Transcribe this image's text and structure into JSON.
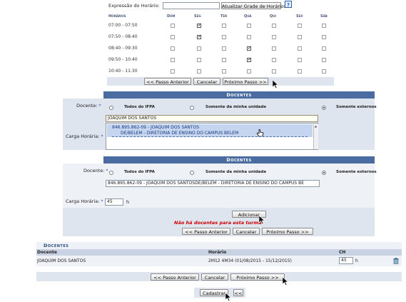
{
  "schedule": {
    "expression_label": "Expressão do Horário:",
    "expression_value": "",
    "update_button": "Atualizar Grade de Horários",
    "help_icon": "?",
    "time_header": "Horários",
    "days": [
      "Dom",
      "Seg",
      "Ter",
      "Qua",
      "Qui",
      "Sex",
      "Sáb"
    ],
    "rows": [
      {
        "time": "07:00 - 07:50",
        "checked": [
          false,
          true,
          false,
          false,
          false,
          false,
          false
        ]
      },
      {
        "time": "07:50 - 08:40",
        "checked": [
          false,
          true,
          false,
          false,
          false,
          false,
          false
        ]
      },
      {
        "time": "08:40 - 09:30",
        "checked": [
          false,
          false,
          false,
          true,
          false,
          false,
          false
        ]
      },
      {
        "time": "09:50 - 10:40",
        "checked": [
          false,
          false,
          false,
          true,
          false,
          false,
          false
        ]
      },
      {
        "time": "10:40 - 11:30",
        "checked": [
          false,
          false,
          false,
          false,
          false,
          false,
          false
        ]
      }
    ]
  },
  "nav1": {
    "prev": "<< Passo Anterior",
    "cancel": "Cancelar",
    "next": "Próximo Passo >>"
  },
  "docentes_panel1": {
    "title": "Docentes",
    "docente_label": "Docente:",
    "required_mark": "*",
    "radio_all": "Todos do IFPA",
    "radio_unit": "Somente da minha unidade",
    "radio_external": "Somente externos",
    "selected_radio": 2,
    "search_value": "JOAQUIM DOS SANTOS",
    "suggestion_line1": "846.895.862-09 - JOAQUIM DOS SANTOS",
    "suggestion_line2": "DE/BELEM - DIRETORIA DE ENSINO DO CAMPUS BELEM",
    "carga_label": "Carga Horária:"
  },
  "docentes_panel2": {
    "title": "Docentes",
    "docente_label": "Docente:",
    "required_mark": "*",
    "radio_all": "Todos do IFPA",
    "radio_unit": "Somente da minha unidade",
    "radio_external": "Somente externos",
    "selected_radio": 2,
    "docente_value": "846.895.862-09 - JOAQUIM DOS SANTOSDE/BELEM - DIRETORIA DE ENSINO DO CAMPUS BE",
    "carga_label": "Carga Horária:",
    "carga_value": "45",
    "carga_unit": "h",
    "add_button": "Adicionar",
    "empty_message": "Não há docentes para esta turma."
  },
  "nav2": {
    "prev": "<< Passo Anterior",
    "cancel": "Cancelar",
    "next": "Próximo Passo >>"
  },
  "docentes_list": {
    "title": "Docentes",
    "columns": [
      "Docente",
      "Horário",
      "CH"
    ],
    "rows": [
      {
        "docente": "JOAQUIM DOS SANTOS",
        "horario": "2M12 4M34 (01/08/2015 - 15/12/2015)",
        "ch": "45",
        "unit": "h"
      }
    ]
  },
  "nav3": {
    "prev": "<< Passo Anterior",
    "cancel": "Cancelar",
    "next": "Próximo Passo >>"
  },
  "final": {
    "submit": "Cadastrar",
    "back": "<<"
  },
  "colors": {
    "header_blue": "#4a6ca0",
    "panel_bg": "#dfe5ef",
    "error_red": "#cc0000"
  }
}
